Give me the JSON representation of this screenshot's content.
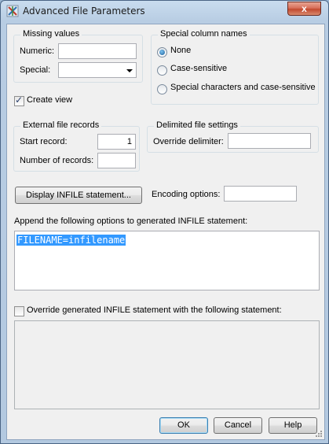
{
  "window": {
    "title": "Advanced File Parameters",
    "close_label": "x"
  },
  "missing_values": {
    "legend": "Missing values",
    "numeric_label": "Numeric:",
    "numeric_value": "",
    "special_label": "Special:",
    "special_value": ""
  },
  "special_column_names": {
    "legend": "Special column names",
    "options": [
      "None",
      "Case-sensitive",
      "Special characters and case-sensitive"
    ],
    "selected": "None"
  },
  "create_view": {
    "label": "Create view",
    "checked": true
  },
  "external_file_records": {
    "legend": "External file records",
    "start_label": "Start record:",
    "start_value": "1",
    "number_label": "Number of records:",
    "number_value": ""
  },
  "delimited_file_settings": {
    "legend": "Delimited file settings",
    "override_label": "Override delimiter:",
    "override_value": ""
  },
  "display_infile_button": "Display INFILE statement...",
  "encoding": {
    "label": "Encoding options:",
    "value": ""
  },
  "append": {
    "label": "Append the following options to generated INFILE statement:",
    "text": "FILENAME=infilename"
  },
  "override_statement": {
    "label": "Override generated INFILE statement with the following statement:",
    "checked": false,
    "text": ""
  },
  "buttons": {
    "ok": "OK",
    "cancel": "Cancel",
    "help": "Help"
  }
}
